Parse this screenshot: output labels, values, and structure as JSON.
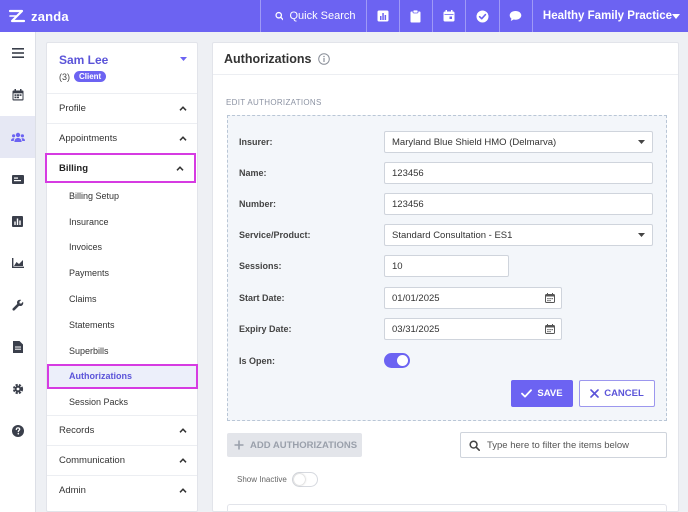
{
  "topbar": {
    "logo_text": "zanda",
    "quick_search": "Quick Search",
    "practice_name": "Healthy Family Practice",
    "accent": "#6c63f2"
  },
  "rail": {
    "icons": [
      "menu-icon",
      "calendar-icon",
      "clients-icon",
      "id-card-icon",
      "chart-icon",
      "trend-chart-icon",
      "wrench-icon",
      "document-icon",
      "gear-icon",
      "help-icon"
    ]
  },
  "client": {
    "name": "Sam Lee",
    "count": "(3)",
    "badge": "Client"
  },
  "nav": {
    "profile": "Profile",
    "appointments": "Appointments",
    "billing": "Billing",
    "billing_items": [
      "Billing Setup",
      "Insurance",
      "Invoices",
      "Payments",
      "Claims",
      "Statements",
      "Superbills",
      "Authorizations",
      "Session Packs"
    ],
    "records": "Records",
    "communication": "Communication",
    "admin": "Admin"
  },
  "main": {
    "title": "Authorizations",
    "section_label": "EDIT AUTHORIZATIONS",
    "form": {
      "insurer_label": "Insurer:",
      "insurer_value": "Maryland Blue Shield HMO (Delmarva)",
      "name_label": "Name:",
      "name_value": "123456",
      "number_label": "Number:",
      "number_value": "123456",
      "service_label": "Service/Product:",
      "service_value": "Standard Consultation - ES1",
      "sessions_label": "Sessions:",
      "sessions_value": "10",
      "start_label": "Start Date:",
      "start_value": "01/01/2025",
      "expiry_label": "Expiry Date:",
      "expiry_value": "03/31/2025",
      "open_label": "Is Open:",
      "is_open": true,
      "save": "SAVE",
      "cancel": "CANCEL"
    },
    "add_button": "ADD AUTHORIZATIONS",
    "filter_placeholder": "Type here to filter the items below",
    "show_inactive": "Show Inactive"
  }
}
